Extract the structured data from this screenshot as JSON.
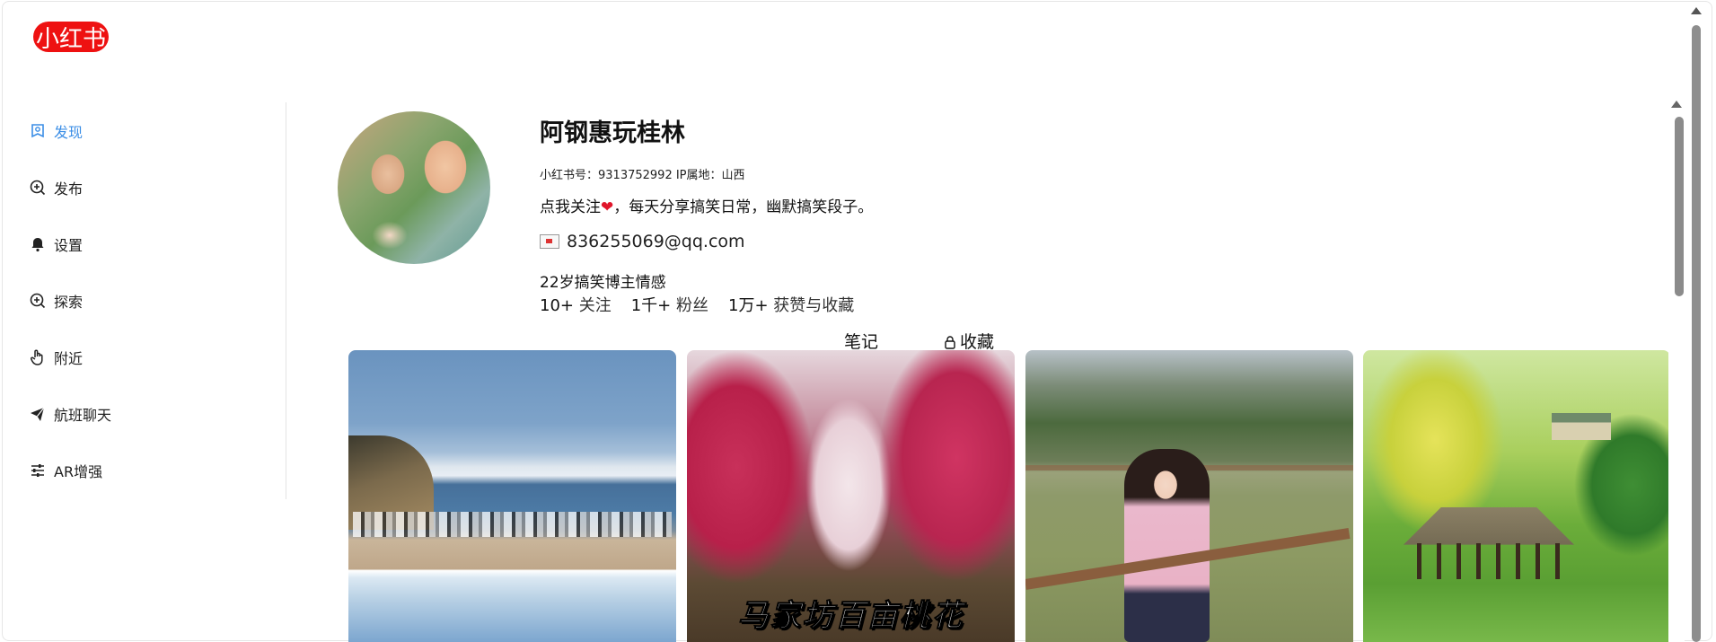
{
  "app": {
    "logo_text": "小红书",
    "brand_color": "#ee1111",
    "accent_color": "#3b8ee6"
  },
  "sidebar": {
    "items": [
      {
        "label": "发现",
        "icon": "discover-icon",
        "active": true
      },
      {
        "label": "发布",
        "icon": "publish-icon",
        "active": false
      },
      {
        "label": "设置",
        "icon": "bell-icon",
        "active": false
      },
      {
        "label": "探索",
        "icon": "explore-icon",
        "active": false
      },
      {
        "label": "附近",
        "icon": "hand-icon",
        "active": false
      },
      {
        "label": "航班聊天",
        "icon": "paper-plane-icon",
        "active": false
      },
      {
        "label": "AR增强",
        "icon": "sliders-icon",
        "active": false
      }
    ]
  },
  "profile": {
    "name": "阿钢惠玩桂林",
    "id_line": "小红书号：9313752992 IP属地：山西",
    "bio_prefix": "点我关注",
    "bio_heart": "❤",
    "bio_suffix": "，每天分享搞笑日常，幽默搞笑段子。",
    "email": "836255069@qq.com",
    "tagline": "22岁搞笑博主情感",
    "stats": [
      {
        "num": "10+",
        "label": "关注"
      },
      {
        "num": "1千+",
        "label": "粉丝"
      },
      {
        "num": "1万+",
        "label": "获赞与收藏"
      }
    ]
  },
  "tabs": {
    "notes": "笔记",
    "collect": "收藏"
  },
  "cards": [
    {
      "title": ""
    },
    {
      "title": "马家坊百亩桃花"
    },
    {
      "title": ""
    },
    {
      "title": ""
    }
  ]
}
